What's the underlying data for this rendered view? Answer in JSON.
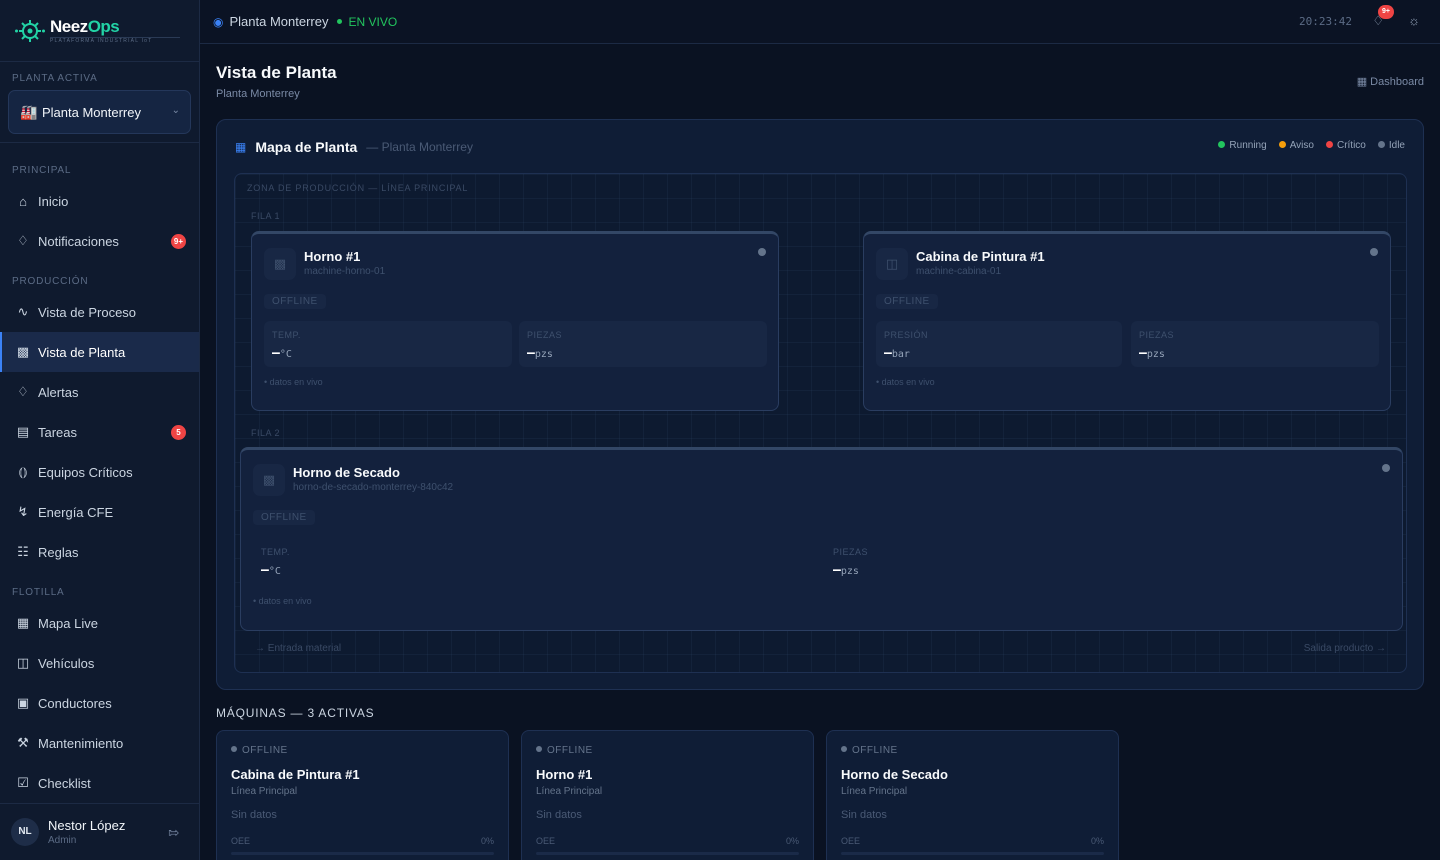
{
  "brand": {
    "name_a": "Neez",
    "name_b": "Ops",
    "tagline": "PLATAFORMA INDUSTRIAL IoT",
    "accent": "#22d3a6"
  },
  "sidebar": {
    "plant_section": "PLANTA ACTIVA",
    "plant_select": {
      "value": "Planta Monterrey",
      "icon": "factory-icon"
    },
    "sections": {
      "principal": "PRINCIPAL",
      "produccion": "PRODUCCIÓN",
      "flotilla": "FLOTILLA"
    },
    "items": [
      {
        "label": "Inicio",
        "icon": "home-icon"
      },
      {
        "label": "Notificaciones",
        "icon": "bell-icon",
        "badge": "9+"
      },
      {
        "label": "Vista de Proceso",
        "icon": "process-icon"
      },
      {
        "label": "Vista de Planta",
        "icon": "factory-icon",
        "active": true
      },
      {
        "label": "Alertas",
        "icon": "bell-icon"
      },
      {
        "label": "Tareas",
        "icon": "clipboard-icon",
        "badge": "5"
      },
      {
        "label": "Equipos Críticos",
        "icon": "critical-equipment-icon"
      },
      {
        "label": "Energía CFE",
        "icon": "bolt-icon"
      },
      {
        "label": "Reglas",
        "icon": "sliders-icon"
      },
      {
        "label": "Mapa Live",
        "icon": "map-icon"
      },
      {
        "label": "Vehículos",
        "icon": "car-icon"
      },
      {
        "label": "Conductores",
        "icon": "id-badge-icon"
      },
      {
        "label": "Mantenimiento",
        "icon": "wrench-icon"
      },
      {
        "label": "Checklist",
        "icon": "checklist-icon"
      }
    ],
    "user": {
      "initials": "NL",
      "name": "Nestor López",
      "role": "Admin"
    }
  },
  "topbar": {
    "location": "Planta Monterrey",
    "live_label": "EN VIVO",
    "clock": "20:23:42",
    "notif_badge": "9+"
  },
  "header": {
    "title": "Vista de Planta",
    "subtitle": "Planta Monterrey",
    "dashboard_link": "Dashboard"
  },
  "map": {
    "title": "Mapa de Planta",
    "subtitle": "— Planta Monterrey",
    "legend": [
      {
        "label": "Running",
        "color": "#22c55e"
      },
      {
        "label": "Aviso",
        "color": "#f59e0b"
      },
      {
        "label": "Crítico",
        "color": "#ef4444"
      },
      {
        "label": "Idle",
        "color": "#64748b"
      }
    ],
    "zone_label": "ZONA DE PRODUCCIÓN — LÍNEA PRINCIPAL",
    "row1_label": "FILA 1",
    "row2_label": "FILA 2",
    "flow_in": "→  Entrada material",
    "flow_out": "Salida producto  →",
    "machines": [
      {
        "name": "Horno #1",
        "id": "machine-horno-01",
        "status": "OFFLINE",
        "m1_label": "TEMP.",
        "m1_value": "—",
        "m1_unit": "°C",
        "m2_label": "PIEZAS",
        "m2_value": "—",
        "m2_unit": "pzs",
        "live": "datos en vivo"
      },
      {
        "name": "Cabina de Pintura #1",
        "id": "machine-cabina-01",
        "status": "OFFLINE",
        "m1_label": "PRESIÓN",
        "m1_value": "—",
        "m1_unit": "bar",
        "m2_label": "PIEZAS",
        "m2_value": "—",
        "m2_unit": "pzs",
        "live": "datos en vivo"
      },
      {
        "name": "Horno de Secado",
        "id": "horno-de-secado-monterrey-840c42",
        "status": "OFFLINE",
        "m1_label": "TEMP.",
        "m1_value": "—",
        "m1_unit": "°C",
        "m2_label": "PIEZAS",
        "m2_value": "—",
        "m2_unit": "pzs",
        "live": "datos en vivo"
      }
    ]
  },
  "machines_list": {
    "title": "MÁQUINAS — 3 ACTIVAS",
    "cards": [
      {
        "status": "OFFLINE",
        "name": "Cabina de Pintura #1",
        "line": "Línea Principal",
        "nodata": "Sin datos",
        "oee_label": "OEE",
        "oee_value": "0%",
        "oee_fraction": 0
      },
      {
        "status": "OFFLINE",
        "name": "Horno #1",
        "line": "Línea Principal",
        "nodata": "Sin datos",
        "oee_label": "OEE",
        "oee_value": "0%",
        "oee_fraction": 0
      },
      {
        "status": "OFFLINE",
        "name": "Horno de Secado",
        "line": "Línea Principal",
        "nodata": "Sin datos",
        "oee_label": "OEE",
        "oee_value": "0%",
        "oee_fraction": 0
      }
    ]
  }
}
